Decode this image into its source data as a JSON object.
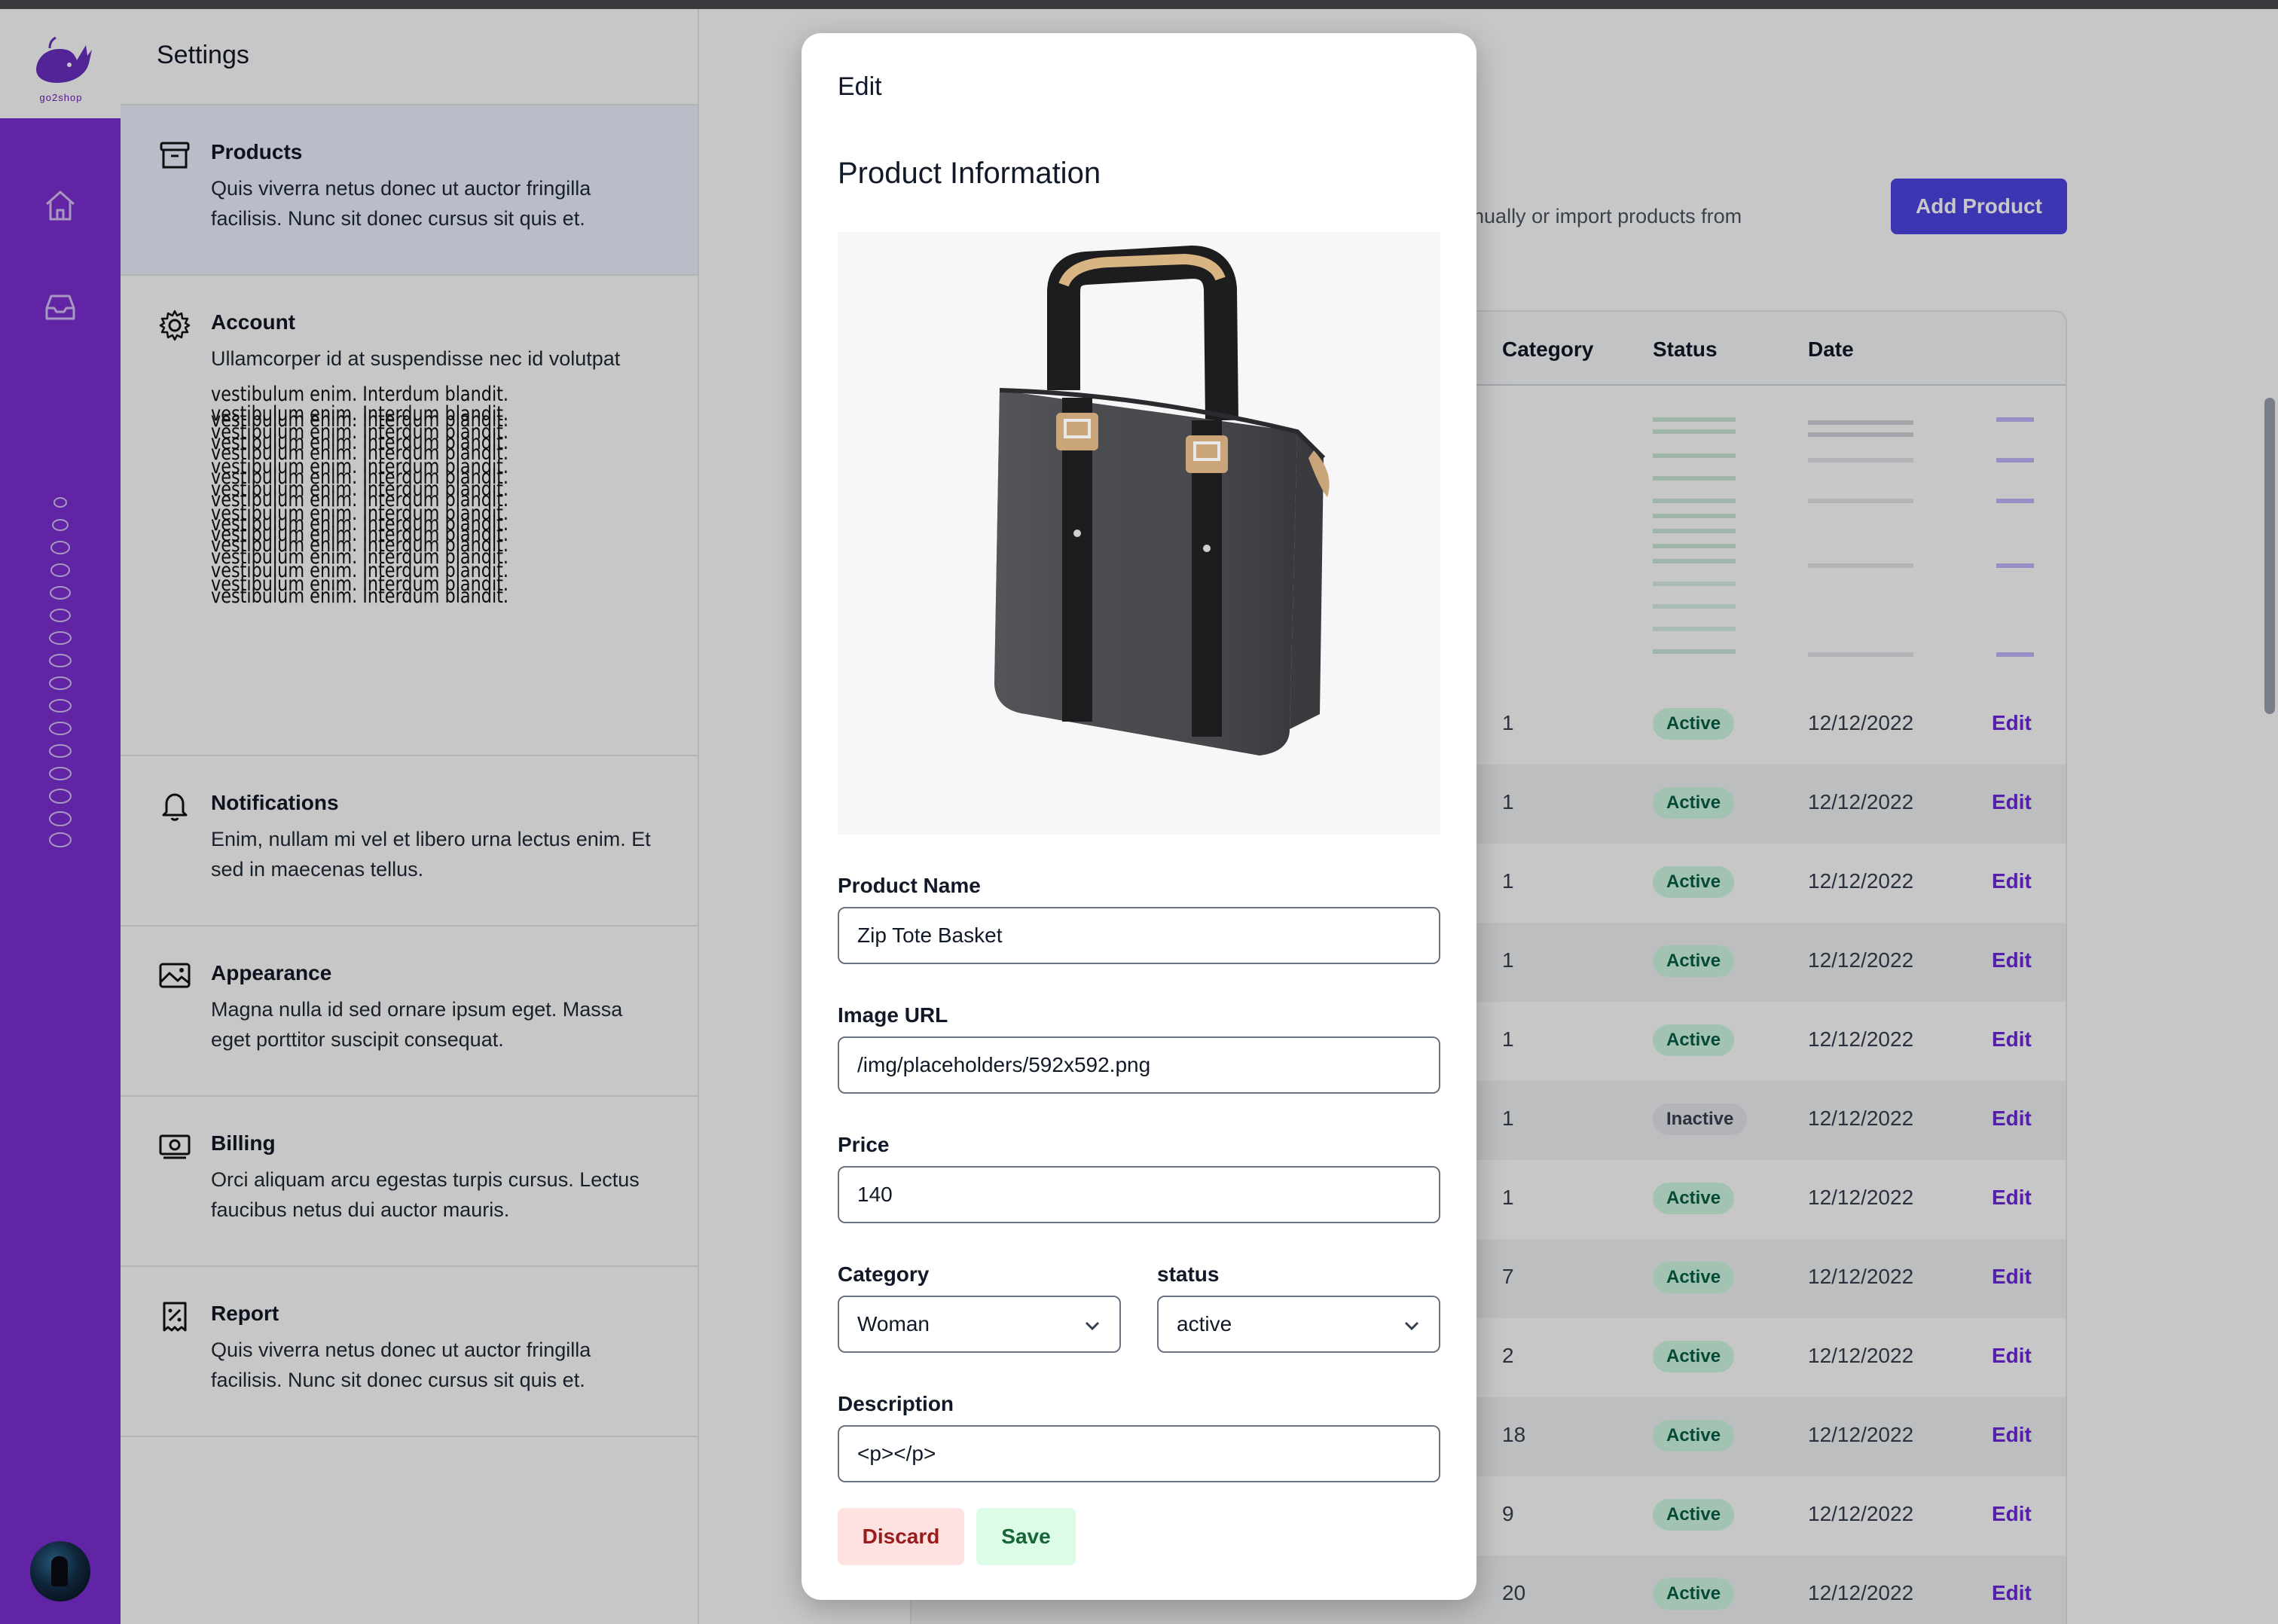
{
  "app": {
    "brand": "go2shop",
    "settings_title": "Settings"
  },
  "rail": {
    "icons": [
      "home-icon",
      "inbox-icon"
    ]
  },
  "settings": {
    "items": [
      {
        "id": "products",
        "icon": "archive-icon",
        "title": "Products",
        "desc": "Quis viverra netus donec ut auctor fringilla facilisis. Nunc sit donec cursus sit quis et.",
        "active": true
      },
      {
        "id": "account",
        "icon": "gear-icon",
        "title": "Account",
        "desc": "Ullamcorper id at suspendisse nec id volutpat",
        "glitch": "vestibulum enim. Interdum blandit."
      },
      {
        "id": "notifications",
        "icon": "bell-icon",
        "title": "Notifications",
        "desc": "Enim, nullam mi vel et libero urna lectus enim. Et sed in maecenas tellus."
      },
      {
        "id": "appearance",
        "icon": "image-icon",
        "title": "Appearance",
        "desc": "Magna nulla id sed ornare ipsum eget. Massa eget porttitor suscipit consequat."
      },
      {
        "id": "billing",
        "icon": "cash-icon",
        "title": "Billing",
        "desc": "Orci aliquam arcu egestas turpis cursus. Lectus faucibus netus dui auctor mauris."
      },
      {
        "id": "report",
        "icon": "receipt-icon",
        "title": "Report",
        "desc": "Quis viverra netus donec ut auctor fringilla facilisis. Nunc sit donec cursus sit quis et."
      }
    ]
  },
  "main": {
    "subtext": "anually or import products from",
    "add_product_label": "Add Product",
    "table": {
      "headers": {
        "category": "Category",
        "status": "Status",
        "date": "Date"
      },
      "rows": [
        {
          "category": "1",
          "status": "Active",
          "date": "12/12/2022",
          "action": "Edit"
        },
        {
          "category": "1",
          "status": "Active",
          "date": "12/12/2022",
          "action": "Edit"
        },
        {
          "category": "1",
          "status": "Active",
          "date": "12/12/2022",
          "action": "Edit"
        },
        {
          "category": "1",
          "status": "Active",
          "date": "12/12/2022",
          "action": "Edit"
        },
        {
          "category": "1",
          "status": "Active",
          "date": "12/12/2022",
          "action": "Edit"
        },
        {
          "category": "1",
          "status": "Inactive",
          "date": "12/12/2022",
          "action": "Edit"
        },
        {
          "category": "1",
          "status": "Active",
          "date": "12/12/2022",
          "action": "Edit"
        },
        {
          "category": "7",
          "status": "Active",
          "date": "12/12/2022",
          "action": "Edit"
        },
        {
          "category": "2",
          "status": "Active",
          "date": "12/12/2022",
          "action": "Edit"
        },
        {
          "category": "18",
          "status": "Active",
          "date": "12/12/2022",
          "action": "Edit"
        },
        {
          "category": "9",
          "status": "Active",
          "date": "12/12/2022",
          "action": "Edit"
        },
        {
          "category": "20",
          "status": "Active",
          "date": "12/12/2022",
          "action": "Edit"
        }
      ]
    }
  },
  "modal": {
    "title": "Edit",
    "heading": "Product Information",
    "product_name_label": "Product Name",
    "product_name_value": "Zip Tote Basket",
    "image_url_label": "Image URL",
    "image_url_value": "/img/placeholders/592x592.png",
    "price_label": "Price",
    "price_value": "140",
    "category_label": "Category",
    "category_value": "Woman",
    "status_label": "status",
    "status_value": "active",
    "description_label": "Description",
    "description_value": "<p></p>",
    "discard_label": "Discard",
    "save_label": "Save"
  },
  "colors": {
    "rail": "#7c2fd4",
    "primary": "#4f46e5",
    "edit_link": "#6d28d9",
    "active_badge_bg": "#d1fae5",
    "active_badge_fg": "#065f46"
  }
}
